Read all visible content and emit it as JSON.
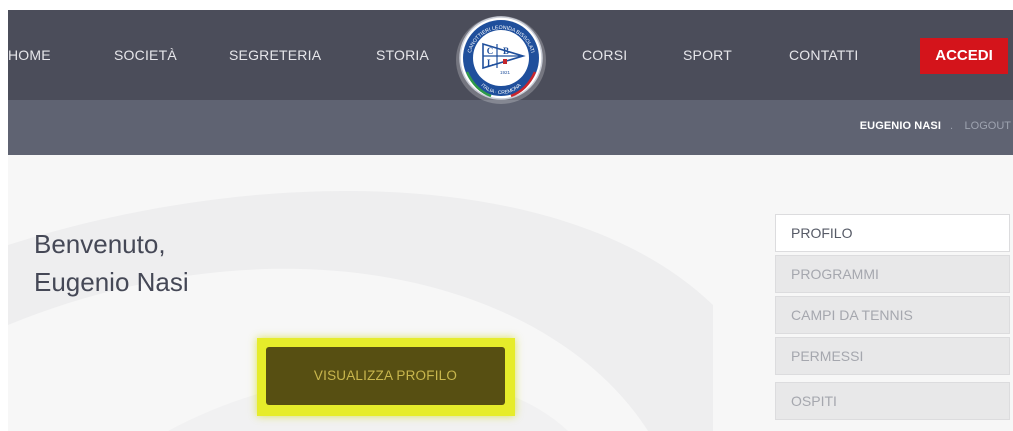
{
  "nav": {
    "items": [
      "HOME",
      "SOCIETÀ",
      "SEGRETERIA",
      "STORIA",
      "CORSI",
      "SPORT",
      "CONTATTI"
    ],
    "login_label": "ACCEDI"
  },
  "logo": {
    "ring_text": "CANOTTIERI LEONIDA BISSOLATI",
    "bottom_text": "ITALIA · CREMONA",
    "letters": [
      "C",
      "B",
      "L"
    ],
    "year": "1921"
  },
  "subbar": {
    "user_name": "EUGENIO NASI",
    "separator": ".",
    "logout": "LOGOUT"
  },
  "main": {
    "welcome_line1": "Benvenuto,",
    "welcome_line2": "Eugenio Nasi",
    "cta_label": "VISUALIZZA PROFILO"
  },
  "side_menu": {
    "items": [
      "PROFILO",
      "PROGRAMMI",
      "CAMPI DA TENNIS",
      "PERMESSI",
      "OSPITI"
    ]
  },
  "colors": {
    "nav_bg": "#4b4d5a",
    "subbar_bg": "#5f6372",
    "accent_red": "#d4141b",
    "cta_highlight": "#e6ec2a",
    "cta_bg": "#574f12"
  }
}
